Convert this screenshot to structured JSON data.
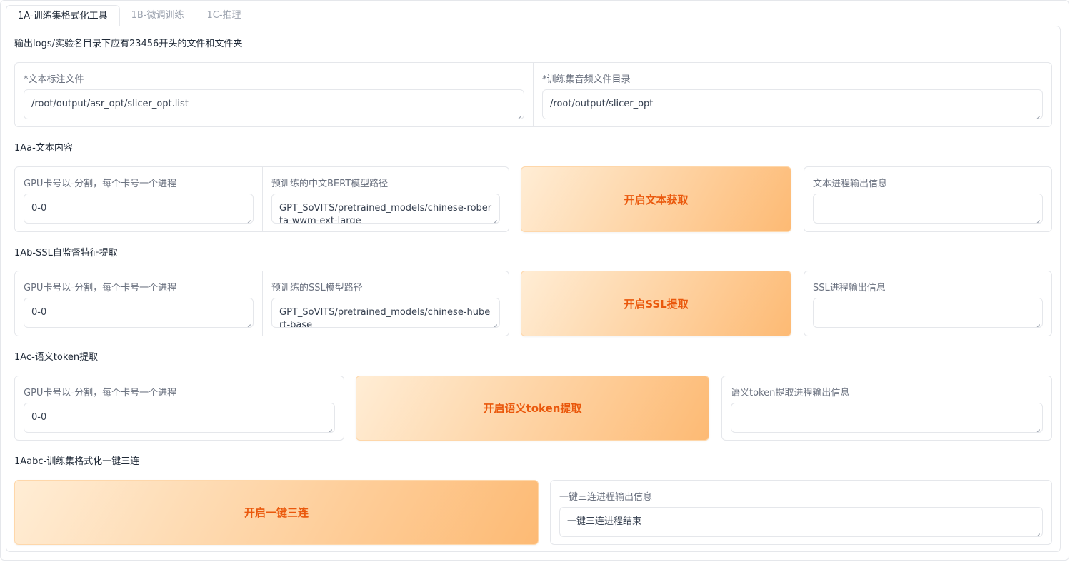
{
  "tabs": [
    "1A-训练集格式化工具",
    "1B-微调训练",
    "1C-推理"
  ],
  "intro": "输出logs/实验名目录下应有23456开头的文件和文件夹",
  "files": {
    "text_label": "*文本标注文件",
    "text_value": "/root/output/asr_opt/slicer_opt.list",
    "audio_label": "*训练集音频文件目录",
    "audio_value": "/root/output/slicer_opt"
  },
  "s1a": {
    "heading": "1Aa-文本内容",
    "gpu_label": "GPU卡号以-分割，每个卡号一个进程",
    "gpu_value": "0-0",
    "model_label": "预训练的中文BERT模型路径",
    "model_value": "GPT_SoVITS/pretrained_models/chinese-roberta-wwm-ext-large",
    "button": "开启文本获取",
    "output_label": "文本进程输出信息",
    "output_value": ""
  },
  "s1b": {
    "heading": "1Ab-SSL自监督特征提取",
    "gpu_label": "GPU卡号以-分割，每个卡号一个进程",
    "gpu_value": "0-0",
    "model_label": "预训练的SSL模型路径",
    "model_value": "GPT_SoVITS/pretrained_models/chinese-hubert-base",
    "button": "开启SSL提取",
    "output_label": "SSL进程输出信息",
    "output_value": ""
  },
  "s1c": {
    "heading": "1Ac-语义token提取",
    "gpu_label": "GPU卡号以-分割，每个卡号一个进程",
    "gpu_value": "0-0",
    "button": "开启语义token提取",
    "output_label": "语义token提取进程输出信息",
    "output_value": ""
  },
  "s1abc": {
    "heading": "1Aabc-训练集格式化一键三连",
    "button": "开启一键三连",
    "output_label": "一键三连进程输出信息",
    "output_value": "一键三连进程结束"
  }
}
